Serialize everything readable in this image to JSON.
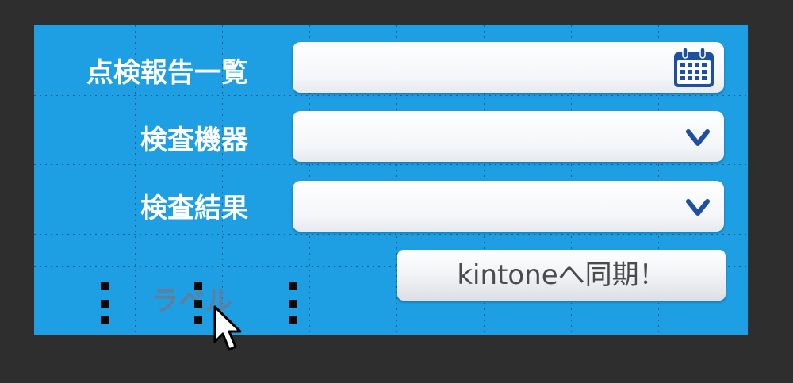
{
  "form": {
    "fields": [
      {
        "label": "点検報告一覧",
        "type": "date",
        "value": "",
        "icon": "calendar-icon"
      },
      {
        "label": "検査機器",
        "type": "select",
        "value": "",
        "icon": "chevron-down-icon"
      },
      {
        "label": "検査結果",
        "type": "select",
        "value": "",
        "icon": "chevron-down-icon"
      }
    ],
    "sync_button_label": "kintoneへ同期！",
    "selected_label_text": "ラベル"
  },
  "colors": {
    "canvas_background": "#1e9fe3",
    "app_background": "#2e2e2e",
    "icon_blue": "#1d4fa5",
    "label_text": "#ffffff"
  }
}
